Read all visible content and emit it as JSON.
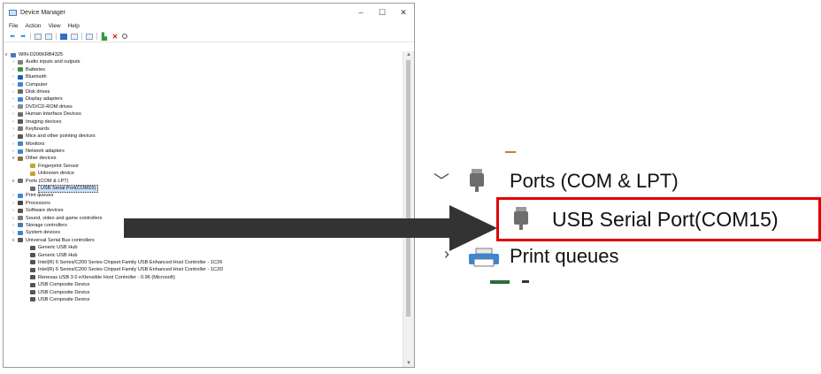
{
  "window": {
    "title": "Device Manager",
    "controls": {
      "minimize": "–",
      "maximize": "☐",
      "close": "✕"
    }
  },
  "menu": [
    "File",
    "Action",
    "View",
    "Help"
  ],
  "toolbar_icons": [
    "back-icon",
    "forward-icon",
    "sep",
    "properties-icon",
    "device-list-icon",
    "sep",
    "help-icon",
    "view-icon",
    "sep",
    "monitor-icon",
    "sep",
    "update-driver-icon",
    "uninstall-icon",
    "scan-hardware-icon"
  ],
  "tree": [
    {
      "label": "WIN-D206KRB4325",
      "depth": 0,
      "twisty": "v",
      "icon": "computer-icon",
      "color": "#4a7ab8"
    },
    {
      "label": "Audio inputs and outputs",
      "depth": 1,
      "twisty": ">",
      "icon": "speaker-icon",
      "color": "#7d7d7d"
    },
    {
      "label": "Batteries",
      "depth": 1,
      "twisty": ">",
      "icon": "battery-icon",
      "color": "#3f8f3f"
    },
    {
      "label": "Bluetooth",
      "depth": 1,
      "twisty": ">",
      "icon": "bluetooth-icon",
      "color": "#1f5fb5"
    },
    {
      "label": "Computer",
      "depth": 1,
      "twisty": ">",
      "icon": "computer-icon",
      "color": "#3a86d4"
    },
    {
      "label": "Disk drives",
      "depth": 1,
      "twisty": ">",
      "icon": "disk-drive-icon",
      "color": "#666666"
    },
    {
      "label": "Display adapters",
      "depth": 1,
      "twisty": ">",
      "icon": "display-adapter-icon",
      "color": "#3a86d4"
    },
    {
      "label": "DVD/CD-ROM drives",
      "depth": 1,
      "twisty": ">",
      "icon": "dvd-drive-icon",
      "color": "#888888"
    },
    {
      "label": "Human Interface Devices",
      "depth": 1,
      "twisty": ">",
      "icon": "hid-icon",
      "color": "#6b6b6b"
    },
    {
      "label": "Imaging devices",
      "depth": 1,
      "twisty": ">",
      "icon": "camera-icon",
      "color": "#555555"
    },
    {
      "label": "Keyboards",
      "depth": 1,
      "twisty": ">",
      "icon": "keyboard-icon",
      "color": "#777777"
    },
    {
      "label": "Mice and other pointing devices",
      "depth": 1,
      "twisty": ">",
      "icon": "mouse-icon",
      "color": "#555555"
    },
    {
      "label": "Monitors",
      "depth": 1,
      "twisty": ">",
      "icon": "monitor-icon",
      "color": "#3a86d4"
    },
    {
      "label": "Network adapters",
      "depth": 1,
      "twisty": ">",
      "icon": "network-adapter-icon",
      "color": "#3a86d4"
    },
    {
      "label": "Other devices",
      "depth": 1,
      "twisty": "v",
      "icon": "other-devices-icon",
      "color": "#8a6d3b"
    },
    {
      "label": "Fingerprint Sensor",
      "depth": 2,
      "twisty": "",
      "icon": "warning-device-icon",
      "color": "#c8a13a"
    },
    {
      "label": "Unknown device",
      "depth": 2,
      "twisty": "",
      "icon": "warning-device-icon",
      "color": "#c8a13a"
    },
    {
      "label": "Ports (COM & LPT)",
      "depth": 1,
      "twisty": "v",
      "icon": "port-icon",
      "color": "#6b6b6b"
    },
    {
      "label": "USB Serial Port(COM15)",
      "depth": 2,
      "twisty": "",
      "icon": "port-icon",
      "color": "#6b6b6b",
      "selected": true
    },
    {
      "label": "Print queues",
      "depth": 1,
      "twisty": ">",
      "icon": "printer-icon",
      "color": "#3a86d4"
    },
    {
      "label": "Processors",
      "depth": 1,
      "twisty": ">",
      "icon": "processor-icon",
      "color": "#444444"
    },
    {
      "label": "Software devices",
      "depth": 1,
      "twisty": ">",
      "icon": "software-device-icon",
      "color": "#555555"
    },
    {
      "label": "Sound, video and game controllers",
      "depth": 1,
      "twisty": ">",
      "icon": "sound-icon",
      "color": "#777777"
    },
    {
      "label": "Storage controllers",
      "depth": 1,
      "twisty": ">",
      "icon": "storage-controller-icon",
      "color": "#4a7ab8"
    },
    {
      "label": "System devices",
      "depth": 1,
      "twisty": ">",
      "icon": "system-device-icon",
      "color": "#3a86d4"
    },
    {
      "label": "Universal Serial Bus controllers",
      "depth": 1,
      "twisty": "v",
      "icon": "usb-icon",
      "color": "#555555"
    },
    {
      "label": "Generic USB Hub",
      "depth": 2,
      "twisty": "",
      "icon": "usb-icon",
      "color": "#555555"
    },
    {
      "label": "Generic USB Hub",
      "depth": 2,
      "twisty": "",
      "icon": "usb-icon",
      "color": "#555555"
    },
    {
      "label": "Intel(R) 6 Series/C200 Series Chipset Family USB Enhanced Host Controller - 1C26",
      "depth": 2,
      "twisty": "",
      "icon": "usb-icon",
      "color": "#555555"
    },
    {
      "label": "Intel(R) 6 Series/C200 Series Chipset Family USB Enhanced Host Controller - 1C2D",
      "depth": 2,
      "twisty": "",
      "icon": "usb-icon",
      "color": "#555555"
    },
    {
      "label": "Renesas USB 3.0 eXtensible Host Controller - 0.96 (Microsoft)",
      "depth": 2,
      "twisty": "",
      "icon": "usb-icon",
      "color": "#555555"
    },
    {
      "label": "USB Composite Device",
      "depth": 2,
      "twisty": "",
      "icon": "usb-icon",
      "color": "#555555"
    },
    {
      "label": "USB Composite Device",
      "depth": 2,
      "twisty": "",
      "icon": "usb-icon",
      "color": "#555555"
    },
    {
      "label": "USB Composite Device",
      "depth": 2,
      "twisty": "",
      "icon": "usb-icon",
      "color": "#555555"
    }
  ],
  "zoom": {
    "ports_label": "Ports (COM & LPT)",
    "usb_serial_label": "USB Serial Port(COM15)",
    "print_label": "Print queues",
    "highlight_color": "#e00000"
  }
}
